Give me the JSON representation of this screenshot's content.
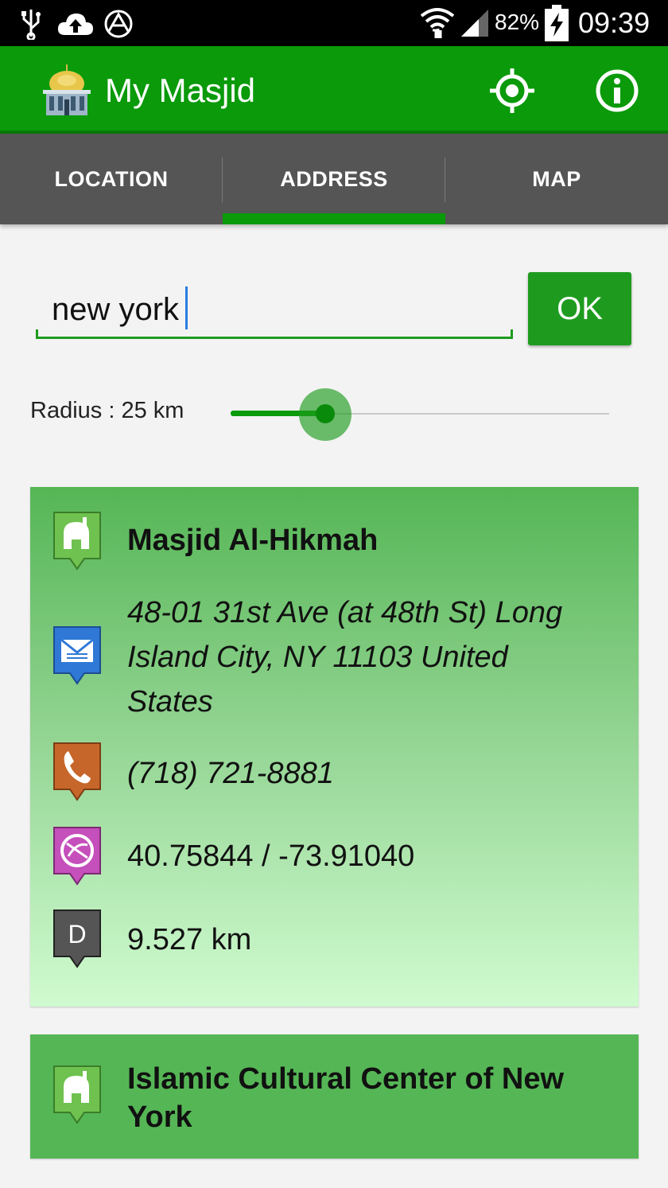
{
  "status_bar": {
    "battery_percent": "82%",
    "time": "09:39",
    "icons": [
      "usb-icon",
      "cloud-upload-icon",
      "logo-app-icon",
      "wifi-icon",
      "signal-icon",
      "battery-charging-icon"
    ]
  },
  "app_bar": {
    "title": "My Masjid",
    "icons": [
      "mosque-logo-icon",
      "locate-icon",
      "info-icon"
    ]
  },
  "tabs": [
    {
      "label": "LOCATION",
      "selected": false
    },
    {
      "label": "ADDRESS",
      "selected": true
    },
    {
      "label": "MAP",
      "selected": false
    }
  ],
  "search": {
    "value": "new york",
    "button_label": "OK"
  },
  "radius": {
    "label": "Radius : 25 km",
    "slider_fraction": 0.25
  },
  "results": [
    {
      "name": "Masjid Al-Hikmah",
      "address": "48-01 31st Ave (at 48th St) Long Island City, NY 11103 United States",
      "address_lines": [
        "48-01 31st Ave (at 48th St) Long",
        "Island City, NY 11103 United",
        "States"
      ],
      "phone": "(718) 721-8881",
      "coordinates": "40.75844 / -73.91040",
      "distance": "9.527 km",
      "distance_pin_letter": "D"
    },
    {
      "name": "Islamic Cultural Center of New York",
      "name_lines": [
        "Islamic Cultural Center of New",
        "York"
      ]
    }
  ],
  "colors": {
    "primary": "#0a9a0a",
    "tab_bg": "#555555",
    "card_top": "#55b655",
    "card_bottom": "#d0fbd0",
    "pin_green": "#6fc24f",
    "pin_blue": "#2f78d6",
    "pin_orange": "#c7662a",
    "pin_magenta": "#c54fbb",
    "pin_gray": "#555555"
  }
}
